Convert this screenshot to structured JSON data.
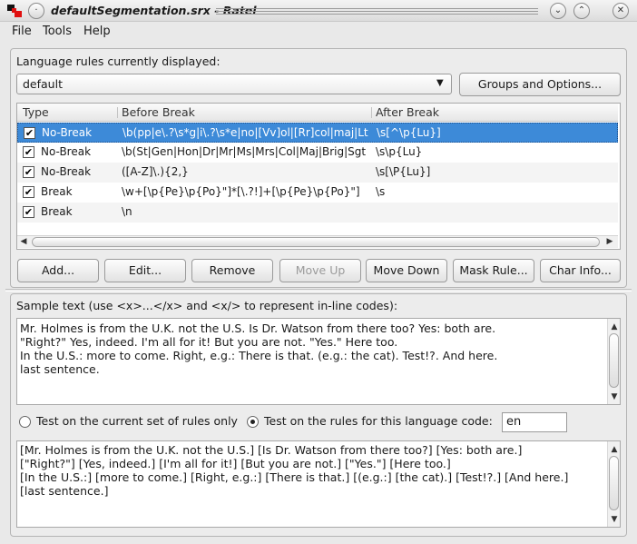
{
  "window": {
    "title": "defaultSegmentation.srx - Ratel",
    "controls": {
      "minimize": "⌄",
      "maximize": "⌃",
      "close": "✕",
      "pin": "·"
    }
  },
  "menu": {
    "file": "File",
    "tools": "Tools",
    "help": "Help"
  },
  "rules_panel": {
    "heading": "Language rules currently displayed:",
    "language_selected": "default",
    "groups_button": "Groups and Options...",
    "columns": {
      "type": "Type",
      "before": "Before Break",
      "after": "After Break"
    },
    "rows": [
      {
        "checked": true,
        "type": "No-Break",
        "before": "\\b(pp|e\\.?\\s*g|i\\.?\\s*e|no|[Vv]ol|[Rr]col|maj|Lt",
        "after": "\\s[^\\p{Lu}]",
        "selected": true
      },
      {
        "checked": true,
        "type": "No-Break",
        "before": "\\b(St|Gen|Hon|Dr|Mr|Ms|Mrs|Col|Maj|Brig|Sgt",
        "after": "\\s\\p{Lu}",
        "selected": false
      },
      {
        "checked": true,
        "type": "No-Break",
        "before": "([A-Z]\\.){2,}",
        "after": "\\s[\\P{Lu}]",
        "selected": false
      },
      {
        "checked": true,
        "type": "Break",
        "before": "\\w+[\\p{Pe}\\p{Po}\"]*[\\.?!]+[\\p{Pe}\\p{Po}\"]",
        "after": "\\s",
        "selected": false
      },
      {
        "checked": true,
        "type": "Break",
        "before": "\\n",
        "after": "",
        "selected": false
      }
    ],
    "buttons": {
      "add": "Add...",
      "edit": "Edit...",
      "remove": "Remove",
      "move_up": "Move Up",
      "move_down": "Move Down",
      "mask_rule": "Mask Rule...",
      "char_info": "Char Info..."
    }
  },
  "sample_panel": {
    "heading": "Sample text (use <x>...</x> and <x/> to represent in-line codes):",
    "sample_lines": [
      "Mr. Holmes is from the U.K. not the U.S. Is Dr. Watson from there too? Yes: both are.",
      "\"Right?\" Yes, indeed. I'm all for it! But you are not. \"Yes.\" Here too.",
      "In the U.S.: more to come. Right, e.g.: There is that. (e.g.: the cat). Test!?. And here.",
      "last sentence."
    ],
    "radio_current": "Test on the current set of rules only",
    "radio_language": "Test on the rules for this language code:",
    "language_code": "en",
    "radio_selected": "language",
    "result_lines": [
      "[Mr. Holmes is from the U.K. not the U.S.] [Is Dr. Watson from there too?] [Yes: both are.]",
      "[\"Right?\"] [Yes, indeed.] [I'm all for it!] [But you are not.] [\"Yes.\"] [Here too.]",
      "[In the U.S.:] [more to come.] [Right, e.g.:] [There is that.] [(e.g.:] [the cat).] [Test!?.] [And here.]",
      "[last sentence.]"
    ]
  },
  "colors": {
    "selection": "#3d8ad8",
    "window_bg": "#e9e9e9"
  }
}
